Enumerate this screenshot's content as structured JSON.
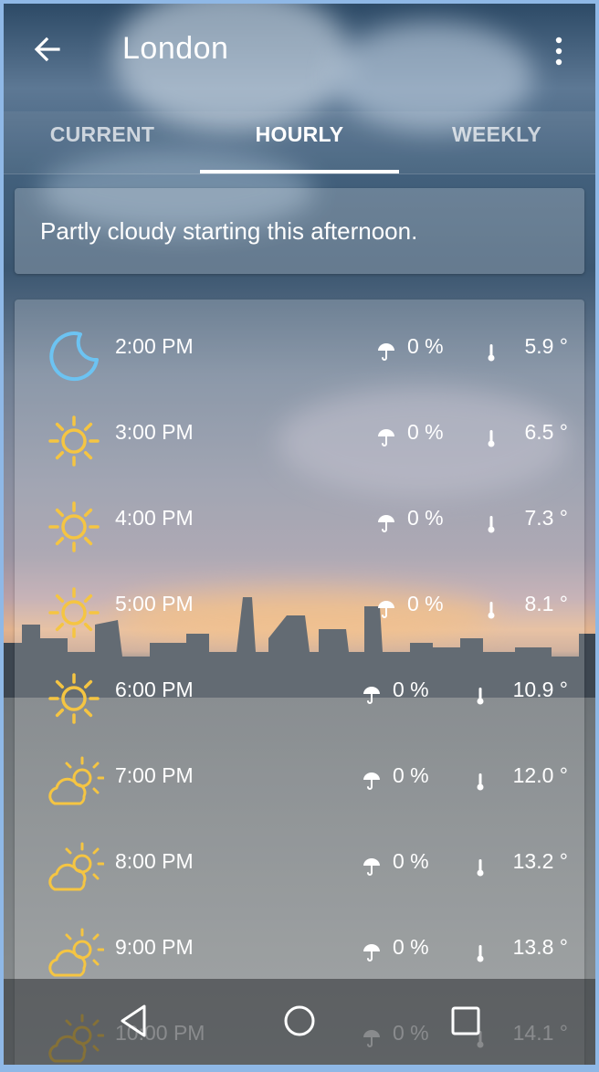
{
  "appbar": {
    "title": "London"
  },
  "tabs": [
    {
      "label": "CURRENT",
      "active": false
    },
    {
      "label": "HOURLY",
      "active": true
    },
    {
      "label": "WEEKLY",
      "active": false
    }
  ],
  "summary": {
    "text": "Partly cloudy starting this afternoon."
  },
  "hourly": [
    {
      "time": "2:00 PM",
      "icon": "moon-icon",
      "precip": "0 %",
      "temp": "5.9 °"
    },
    {
      "time": "3:00 PM",
      "icon": "sun-icon",
      "precip": "0 %",
      "temp": "6.5 °"
    },
    {
      "time": "4:00 PM",
      "icon": "sun-icon",
      "precip": "0 %",
      "temp": "7.3 °"
    },
    {
      "time": "5:00 PM",
      "icon": "sun-icon",
      "precip": "0 %",
      "temp": "8.1 °"
    },
    {
      "time": "6:00 PM",
      "icon": "sun-icon",
      "precip": "0 %",
      "temp": "10.9 °"
    },
    {
      "time": "7:00 PM",
      "icon": "partly-cloudy-icon",
      "precip": "0 %",
      "temp": "12.0 °"
    },
    {
      "time": "8:00 PM",
      "icon": "partly-cloudy-icon",
      "precip": "0 %",
      "temp": "13.2 °"
    },
    {
      "time": "9:00 PM",
      "icon": "partly-cloudy-icon",
      "precip": "0 %",
      "temp": "13.8 °"
    },
    {
      "time": "10:00 PM",
      "icon": "partly-cloudy-icon",
      "precip": "0 %",
      "temp": "14.1 °"
    }
  ],
  "colors": {
    "sun": "#f5c542",
    "moon": "#6cc3f2",
    "accent": "#ffffff"
  },
  "navbar": {
    "icons": [
      "back-triangle-icon",
      "home-circle-icon",
      "recents-square-icon"
    ]
  }
}
